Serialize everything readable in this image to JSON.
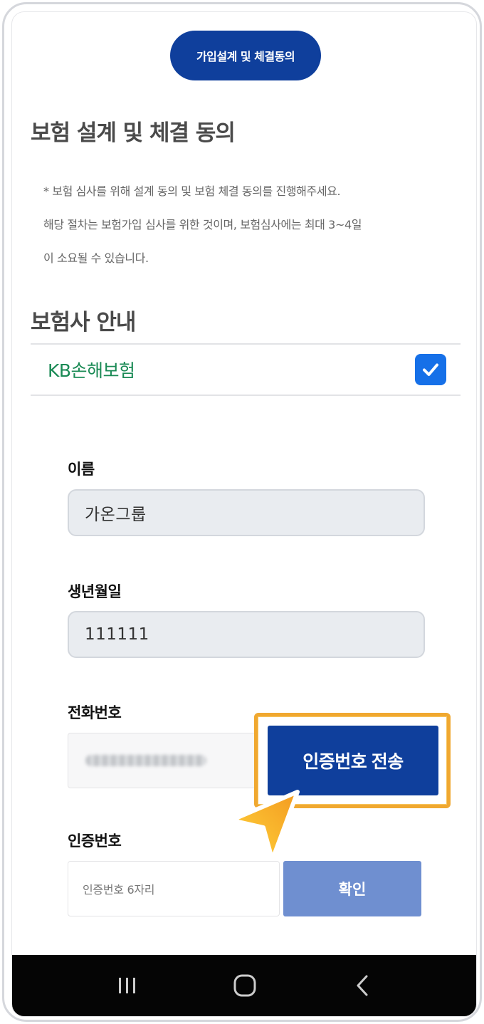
{
  "step_pill": {
    "label": "가입설계 및 체결동의"
  },
  "page_title": "보험 설계 및 체결 동의",
  "notice": {
    "line1": "* 보험 심사를 위해 설계 동의 및 보험 체결 동의를 진행해주세요.",
    "line2": "해당 절차는 보험가입 심사를 위한 것이며, 보험심사에는 최대 3~4일",
    "line3": "이 소요될 수 있습니다."
  },
  "insurer_section": {
    "title": "보험사 안내",
    "insurer_name": "KB손해보험",
    "checked": true
  },
  "form": {
    "name_label": "이름",
    "name_value": "가온그룹",
    "birth_label": "생년월일",
    "birth_value": "111111",
    "phone_label": "전화번호",
    "send_code_button": "인증번호 전송",
    "code_label": "인증번호",
    "code_placeholder": "인증번호 6자리",
    "confirm_button": "확인"
  },
  "colors": {
    "primary": "#0f3f9c",
    "confirm_disabled": "#6f8fd0",
    "insurer_text": "#1a8a55",
    "highlight": "#f0a830",
    "checkbox": "#1670e8"
  },
  "icons": {
    "checkbox": "check-icon",
    "pointer": "cursor-pointer-icon",
    "nav": [
      "recent-apps-icon",
      "home-icon",
      "back-icon"
    ]
  }
}
